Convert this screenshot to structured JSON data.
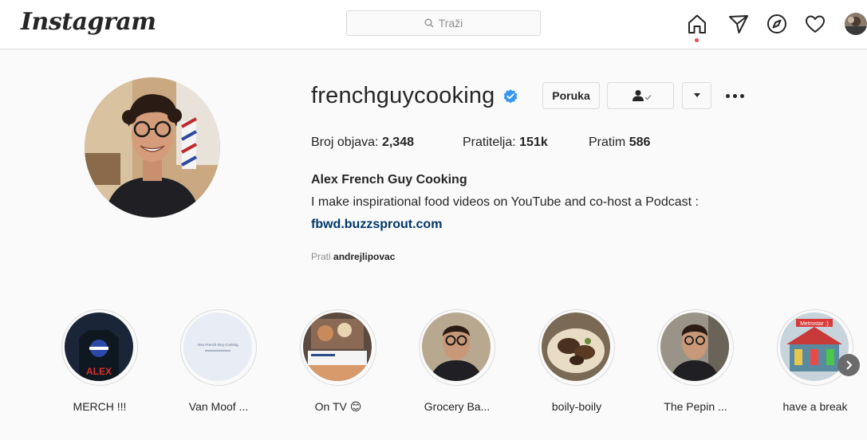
{
  "header": {
    "logo": "Instagram",
    "search_placeholder": "Traži",
    "icons": [
      "home-icon",
      "direct-icon",
      "explore-icon",
      "activity-heart-icon",
      "profile-avatar"
    ]
  },
  "profile": {
    "username": "frenchguycooking",
    "message_button": "Poruka",
    "stats": {
      "posts_label": "Broj objava:",
      "posts": "2,348",
      "followers_label": "Pratitelja:",
      "followers": "151k",
      "following_label": "Pratim",
      "following": "586"
    },
    "full_name": "Alex French Guy Cooking",
    "bio": "I make inspirational food videos on YouTube and co-host a Podcast :",
    "link": "fbwd.buzzsprout.com",
    "followed_by_label": "Prati",
    "followed_by": "andrejlipovac"
  },
  "highlights": [
    {
      "label": "MERCH !!!",
      "art_text": "ALEX"
    },
    {
      "label": "Van Moof ...",
      "art_text": "Alex French Guy Cooking"
    },
    {
      "label": "On TV 😊"
    },
    {
      "label": "Grocery Ba..."
    },
    {
      "label": "boily-boily"
    },
    {
      "label": "The Pepin ..."
    },
    {
      "label": "have a break",
      "art_text": "Metrostar :)"
    }
  ],
  "colors": {
    "background": "#fafafa",
    "border": "#dbdbdb",
    "text": "#262626",
    "secondary_text": "#8e8e8e",
    "link": "#00376b",
    "verified": "#3897f0",
    "notification": "#ed4956"
  }
}
